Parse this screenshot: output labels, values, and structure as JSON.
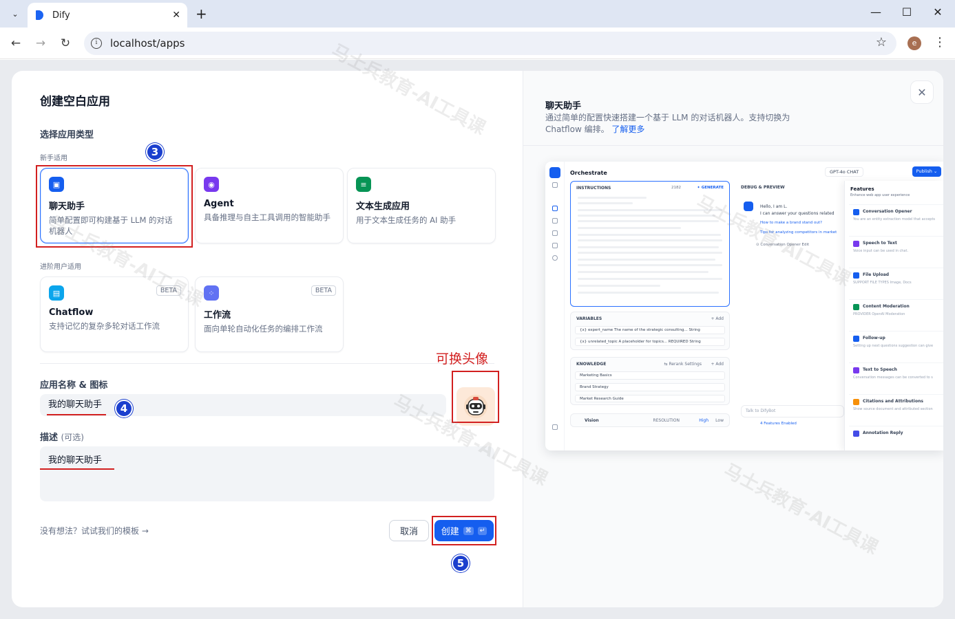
{
  "browser": {
    "tab_title": "Dify",
    "url": "localhost/apps",
    "profile_initial": "e",
    "tab_list_icon": "chevron-down-icon",
    "new_tab_icon": "plus-icon"
  },
  "modal": {
    "title": "创建空白应用",
    "section_app_type": "选择应用类型",
    "group_beginner": "新手适用",
    "group_advanced": "进阶用户适用",
    "cards": [
      {
        "name": "聊天助手",
        "desc": "简单配置即可构建基于 LLM 的对话机器人",
        "color": "#155eef",
        "selected": true
      },
      {
        "name": "Agent",
        "desc": "具备推理与自主工具调用的智能助手",
        "color": "#7839ee"
      },
      {
        "name": "文本生成应用",
        "desc": "用于文本生成任务的 AI 助手",
        "color": "#079455"
      },
      {
        "name": "Chatflow",
        "desc": "支持记忆的复杂多轮对话工作流",
        "color": "#0ba5ec",
        "badge": "BETA"
      },
      {
        "name": "工作流",
        "desc": "面向单轮自动化任务的编排工作流",
        "color": "#6172f3",
        "badge": "BETA"
      }
    ],
    "name_label": "应用名称 & 图标",
    "name_value": "我的聊天助手",
    "desc_label": "描述",
    "desc_optional": "(可选)",
    "desc_value": "我的聊天助手",
    "template_link": "没有想法？试试我们的模板 →",
    "cancel_label": "取消",
    "create_label": "创建",
    "create_kbd_1": "⌘",
    "create_kbd_2": "↵"
  },
  "annotations": {
    "step3": "3",
    "step4": "4",
    "step5": "5",
    "avatar_note": "可换头像"
  },
  "preview": {
    "title": "聊天助手",
    "desc": "通过简单的配置快速搭建一个基于 LLM 的对话机器人。支持切换为 Chatflow 编排。",
    "learn_more": "了解更多",
    "close_icon": "close-icon",
    "screenshot": {
      "header": "Orchestrate",
      "model": "GPT-4o CHAT",
      "publish": "Publish ⌄",
      "instructions": "INSTRUCTIONS",
      "instructions_count": "2182",
      "generate": "✦ GENERATE",
      "variables": "VARIABLES",
      "add": "+ Add",
      "var_rows": [
        "{x} expert_name   The name of the strategic consulting...   String",
        "{x} unrelated_topic   A placeholder for topics...   REQUIRED  String"
      ],
      "knowledge": "KNOWLEDGE",
      "rerank": "⇆ Rerank Settings",
      "kb_rows": [
        "Marketing Basics",
        "Brand Strategy",
        "Market Research Guide"
      ],
      "vision": "Vision",
      "resolution": "RESOLUTION",
      "high": "High",
      "low": "Low",
      "debug": "DEBUG & PREVIEW",
      "chat_1": "Hello, I am L.",
      "chat_2": "I can answer your questions related",
      "sugg_1": "How to make a brand stand out?",
      "sugg_2": "Tips for analyzing competitors in market",
      "opener": "⊙ Conversation Opener   Edit",
      "talk": "Talk to DifyBot",
      "features_enabled": "4 Features Enabled",
      "features_title": "Features",
      "features_sub": "Enhance web app user experience",
      "features": [
        {
          "name": "Conversation Opener",
          "desc": "You are an entity extraction model that accepts",
          "color": "#155eef"
        },
        {
          "name": "Speech to Text",
          "desc": "Voice input can be used in chat.",
          "color": "#7839ee"
        },
        {
          "name": "File Upload",
          "desc": "SUPPORT FILE TYPES  Image, Docs",
          "color": "#155eef"
        },
        {
          "name": "Content Moderation",
          "desc": "PROVIDER  OpenAI Moderation",
          "color": "#079455"
        },
        {
          "name": "Follow-up",
          "desc": "Setting up next questions suggestion can give",
          "color": "#155eef"
        },
        {
          "name": "Text to Speech",
          "desc": "Conversation messages can be converted to s",
          "color": "#7839ee"
        },
        {
          "name": "Citations and Attributions",
          "desc": "Show source document and attributed section",
          "color": "#f79009"
        },
        {
          "name": "Annotation Reply",
          "desc": "",
          "color": "#444ce7"
        }
      ]
    }
  },
  "watermark": "马士兵教育-AI工具课"
}
